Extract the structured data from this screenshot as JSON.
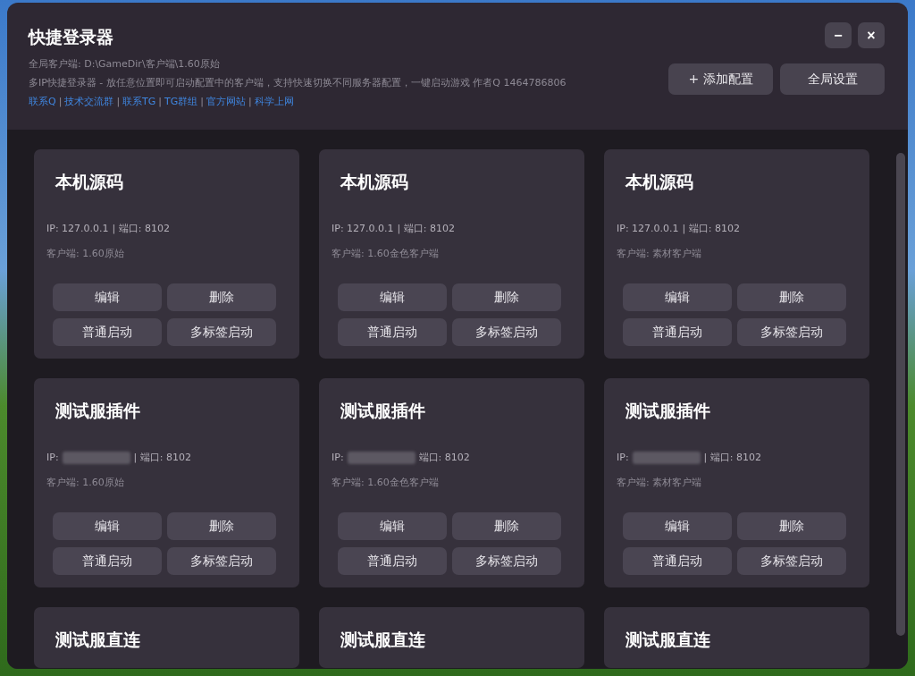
{
  "window": {
    "title": "快捷登录器",
    "client_path": "全局客户端: D:\\GameDir\\客户端\\1.60原始",
    "description": "多IP快捷登录器 - 放任意位置即可启动配置中的客户端，支持快速切换不同服务器配置，一键启动游戏 作者Q 1464786806",
    "links": [
      "联系Q",
      "技术交流群",
      "联系TG",
      "TG群组",
      "官方网站",
      "科学上网"
    ],
    "link_separator": "|",
    "minimize": "−",
    "close": "×"
  },
  "toolbar": [
    "+ 添加配置",
    "全局设置"
  ],
  "cards": [
    {
      "title": "本机源码",
      "ip": "IP: 127.0.0.1",
      "redacted": false,
      "port": "| 端口: 8102",
      "client": "客户端: 1.60原始",
      "buttons": [
        "编辑",
        "删除",
        "普通启动",
        "多标签启动"
      ]
    },
    {
      "title": "本机源码",
      "ip": "IP: 127.0.0.1",
      "redacted": false,
      "port": "| 端口: 8102",
      "client": "客户端: 1.60金色客户端",
      "buttons": [
        "编辑",
        "删除",
        "普通启动",
        "多标签启动"
      ]
    },
    {
      "title": "本机源码",
      "ip": "IP: 127.0.0.1",
      "redacted": false,
      "port": "| 端口: 8102",
      "client": "客户端: 素材客户端",
      "buttons": [
        "编辑",
        "删除",
        "普通启动",
        "多标签启动"
      ]
    },
    {
      "title": "测试服插件",
      "ip": "IP:",
      "redacted": true,
      "port": "| 端口: 8102",
      "client": "客户端: 1.60原始",
      "buttons": [
        "编辑",
        "删除",
        "普通启动",
        "多标签启动"
      ]
    },
    {
      "title": "测试服插件",
      "ip": "IP:",
      "redacted": true,
      "port": "端口: 8102",
      "client": "客户端: 1.60金色客户端",
      "buttons": [
        "编辑",
        "删除",
        "普通启动",
        "多标签启动"
      ]
    },
    {
      "title": "测试服插件",
      "ip": "IP:",
      "redacted": true,
      "port": "| 端口: 8102",
      "client": "客户端: 素材客户端",
      "buttons": [
        "编辑",
        "删除",
        "普通启动",
        "多标签启动"
      ]
    },
    {
      "title": "测试服直连"
    },
    {
      "title": "测试服直连"
    },
    {
      "title": "测试服直连"
    }
  ]
}
